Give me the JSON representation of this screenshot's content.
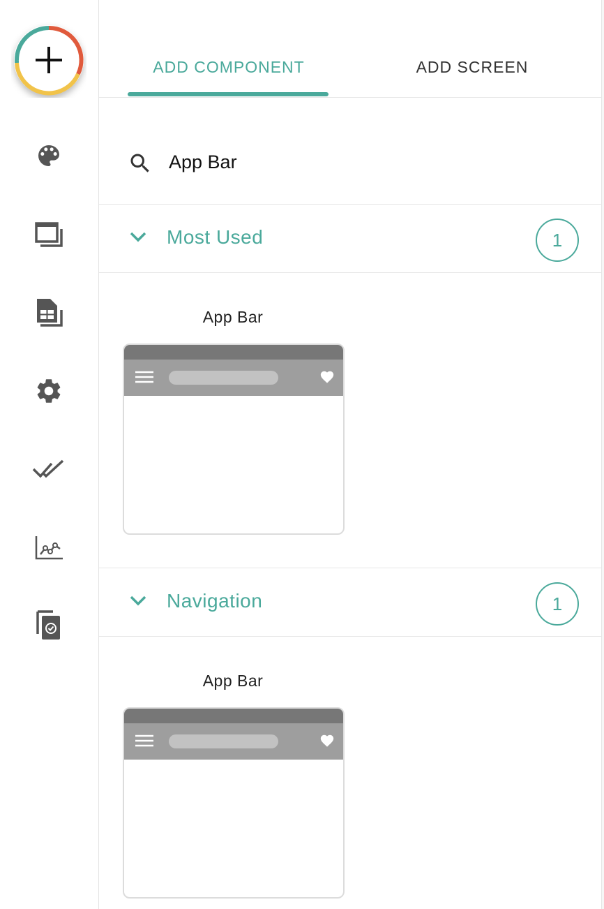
{
  "rail": {
    "fab_icon": "add-icon",
    "fab_ring_colors": [
      "#4aa99b",
      "#e05a3c",
      "#f1c34a"
    ],
    "icons": [
      "palette-icon",
      "screens-icon",
      "data-table-icon",
      "settings-gear-icon",
      "checklist-done-icon",
      "analytics-chart-icon",
      "publish-document-icon"
    ]
  },
  "tabs": [
    {
      "label": "ADD COMPONENT",
      "active": true
    },
    {
      "label": "ADD SCREEN",
      "active": false
    }
  ],
  "search": {
    "value": "App Bar",
    "icon": "search-icon"
  },
  "sections": [
    {
      "title": "Most Used",
      "count": "1",
      "items": [
        {
          "label": "App Bar"
        }
      ]
    },
    {
      "title": "Navigation",
      "count": "1",
      "items": [
        {
          "label": "App Bar"
        }
      ]
    }
  ],
  "colors": {
    "accent": "#4aa99b",
    "icon_gray": "#555555"
  }
}
